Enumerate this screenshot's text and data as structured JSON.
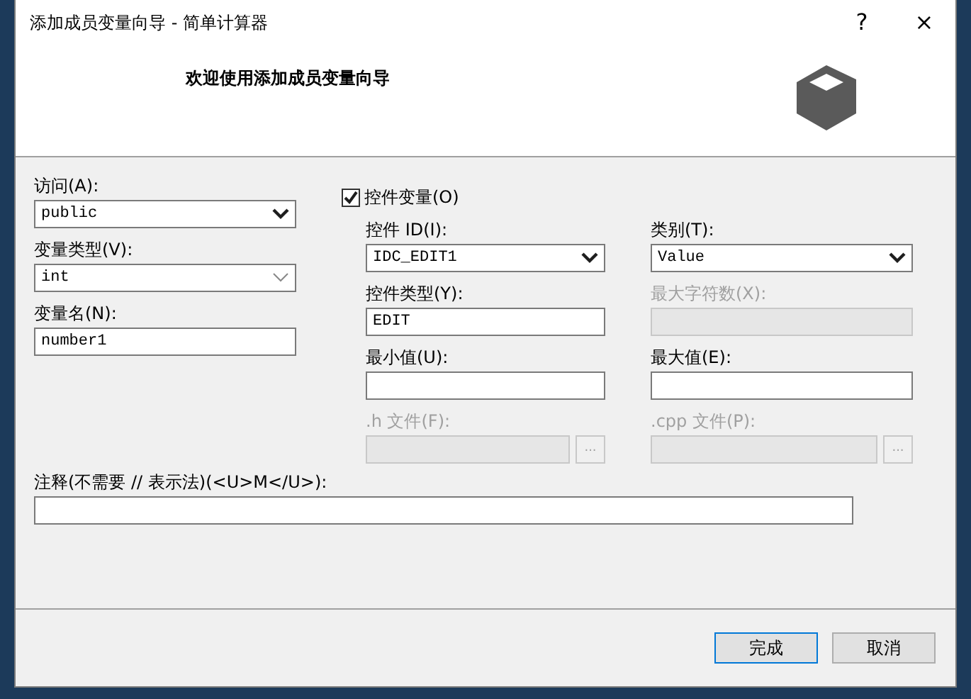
{
  "window": {
    "title": "添加成员变量向导 - 简单计算器",
    "help": "?",
    "close": "×"
  },
  "header": {
    "title": "欢迎使用添加成员变量向导"
  },
  "left_fields": [
    {
      "label": "访问(A):",
      "kind": "dropdown",
      "value": "public",
      "disabled": false
    },
    {
      "label": "变量类型(V):",
      "kind": "combo",
      "value": "int",
      "disabled": false
    },
    {
      "label": "变量名(N):",
      "kind": "text",
      "value": "number1",
      "disabled": false
    }
  ],
  "control_variable": {
    "label": "控件变量(O)",
    "checked": true
  },
  "control_fields": [
    {
      "label": "控件 ID(I):",
      "kind": "dropdown",
      "value": "IDC_EDIT1",
      "disabled": false
    },
    {
      "label": "类别(T):",
      "kind": "dropdown",
      "value": "Value",
      "disabled": false
    },
    {
      "label": "控件类型(Y):",
      "kind": "text",
      "value": "EDIT",
      "disabled": false
    },
    {
      "label": "最大字符数(X):",
      "kind": "text",
      "disabled": true
    },
    {
      "label": "最小值(U):",
      "kind": "text",
      "disabled": false
    },
    {
      "label": "最大值(E):",
      "kind": "text",
      "disabled": false
    },
    {
      "label": ".h 文件(F):",
      "kind": "file",
      "browse": "...",
      "disabled": true
    },
    {
      "label": ".cpp 文件(P):",
      "kind": "file",
      "browse": "...",
      "disabled": true
    }
  ],
  "comment": {
    "label": "注释(不需要 // 表示法)(<U>M</U>):"
  },
  "buttons": [
    {
      "label": "完成"
    },
    {
      "label": "取消"
    }
  ]
}
